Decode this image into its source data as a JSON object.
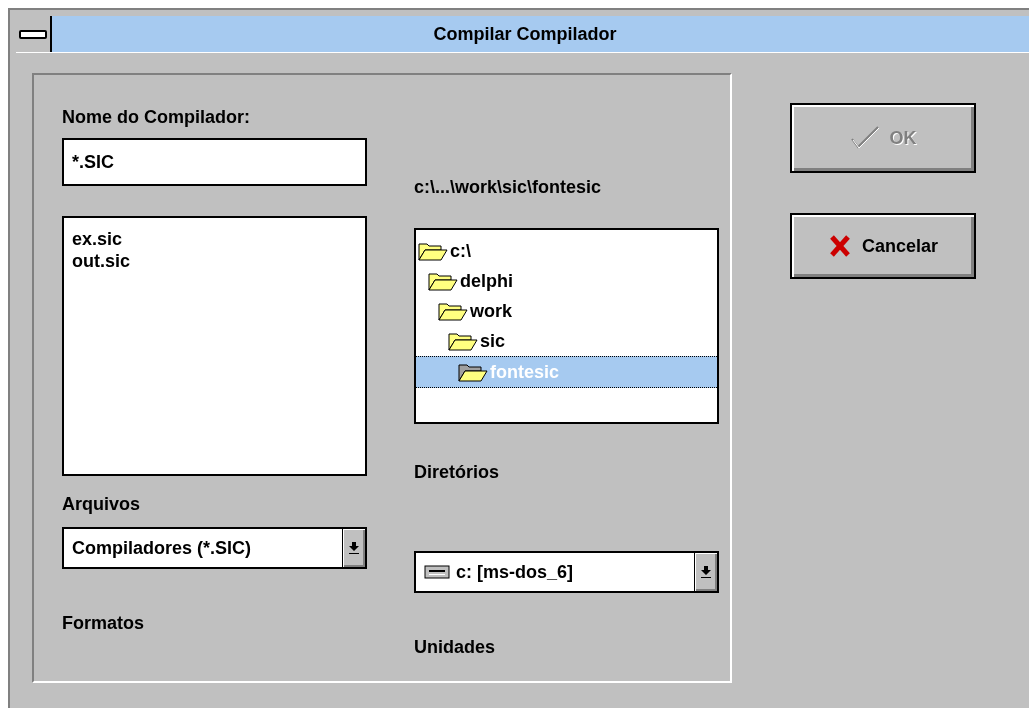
{
  "window": {
    "title": "Compilar Compilador"
  },
  "name_field": {
    "label": "Nome do Compilador:",
    "value": "*.SIC"
  },
  "files": {
    "items": [
      {
        "label": "ex.sic",
        "selected": false
      },
      {
        "label": "out.sic",
        "selected": false
      }
    ],
    "label": "Arquivos"
  },
  "current_path": "c:\\...\\work\\sic\\fontesic",
  "directories": {
    "items": [
      {
        "label": "c:\\",
        "selected": false,
        "children": [
          {
            "label": "delphi",
            "selected": false,
            "children": [
              {
                "label": "work",
                "selected": false,
                "children": [
                  {
                    "label": "sic",
                    "selected": false,
                    "children": [
                      {
                        "label": "fontesic",
                        "selected": true
                      }
                    ]
                  }
                ]
              }
            ]
          }
        ]
      }
    ],
    "label": "Diretórios"
  },
  "formats": {
    "value": "Compiladores (*.SIC)",
    "label": "Formatos"
  },
  "drives": {
    "value": "c: [ms-dos_6]",
    "label": "Unidades"
  },
  "buttons": [
    {
      "kind": "ok",
      "label": "OK",
      "disabled": true
    },
    {
      "kind": "cancel",
      "label": "Cancelar",
      "disabled": false
    }
  ]
}
